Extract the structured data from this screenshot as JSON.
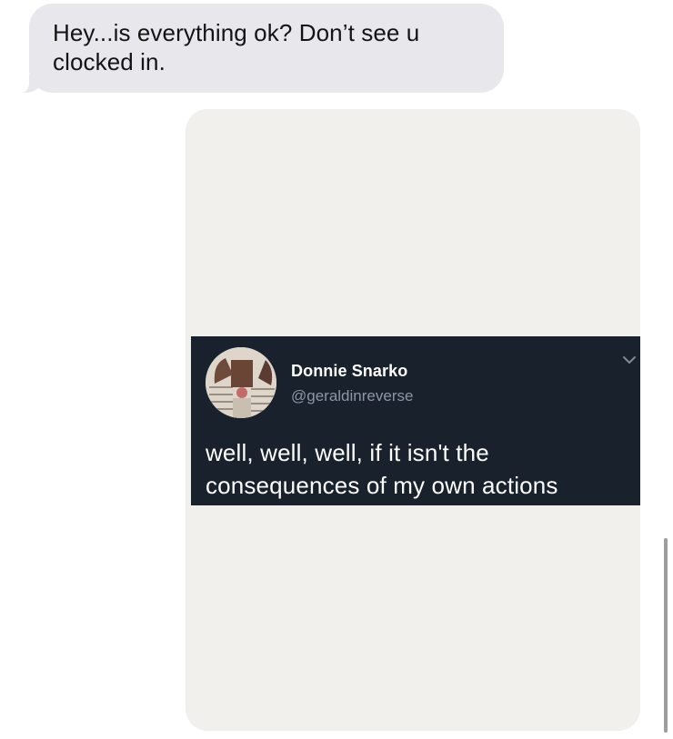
{
  "conversation": {
    "incoming_message": {
      "text": "Hey...is everything ok? Don’t see u clocked in."
    },
    "image_attachment": {
      "tweet": {
        "display_name": "Donnie Snarko",
        "handle": "@geraldinreverse",
        "text": "well, well, well, if it isn't the consequences of my own actions"
      }
    }
  },
  "icons": {
    "tweet_menu": "chevron-down-icon",
    "avatar": "avatar"
  },
  "colors": {
    "incoming_bubble": "#e7e7ec",
    "attachment_background": "#f1f0ec",
    "tweet_background": "#18212c",
    "tweet_text": "#ffffff",
    "tweet_handle": "#8b97a3"
  }
}
